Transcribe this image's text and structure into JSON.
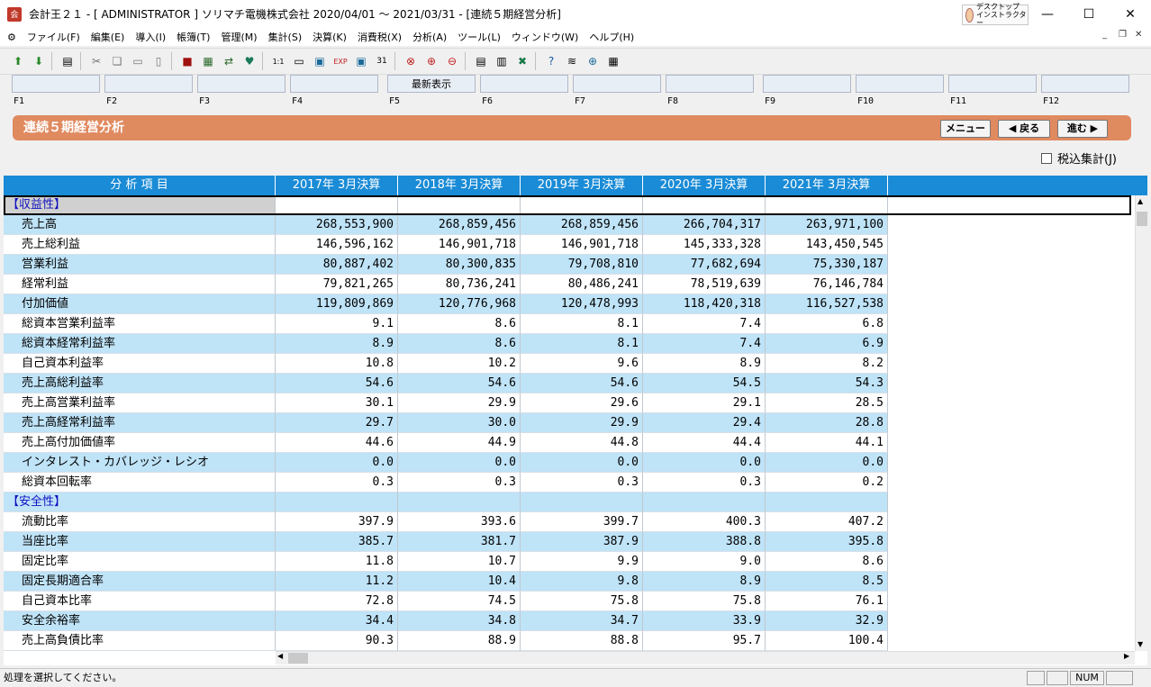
{
  "window": {
    "title": "会計王２１ - [ ADMINISTRATOR ] ソリマチ電機株式会社 2020/04/01 〜 2021/03/31 - [連続５期経営分析]",
    "app_icon": "会",
    "desktop_instructor": "デスクトップ インストラクター",
    "minimize": "—",
    "maximize": "☐",
    "close": "✕"
  },
  "menu": {
    "items": [
      "ファイル(F)",
      "編集(E)",
      "導入(I)",
      "帳簿(T)",
      "管理(M)",
      "集計(S)",
      "決算(K)",
      "消費税(X)",
      "分析(A)",
      "ツール(L)",
      "ウィンドウ(W)",
      "ヘルプ(H)"
    ]
  },
  "toolbar": {
    "icons": [
      "open-icon",
      "save-icon",
      "print-preview-icon",
      "cut-icon",
      "copy-icon",
      "paste-icon",
      "clipboard-icon",
      "book-icon",
      "journal-icon",
      "transfer-icon",
      "heart-icon",
      "easy-icon",
      "keyboard-icon",
      "voucher-icon",
      "export-icon",
      "import-icon",
      "calendar-icon",
      "delete-icon",
      "calendar-add-icon",
      "calendar-delete-icon",
      "table-icon",
      "table2-icon",
      "excel-icon",
      "help-icon",
      "layers-icon",
      "globe-icon",
      "calculator-icon"
    ]
  },
  "fkeys": {
    "buttons": [
      "",
      "",
      "",
      "",
      "最新表示",
      "",
      "",
      "",
      "",
      "",
      "",
      ""
    ],
    "labels": [
      "F1",
      "F2",
      "F3",
      "F4",
      "F5",
      "F6",
      "F7",
      "F8",
      "F9",
      "F10",
      "F11",
      "F12"
    ]
  },
  "banner": {
    "title": "連続５期経営分析",
    "menu": "メニュー",
    "back": "◀ 戻る",
    "forward": "進む ▶"
  },
  "tax_toggle": {
    "label": "税込集計(J)"
  },
  "table": {
    "headers": [
      "分 析 項 目",
      "2017年 3月決算",
      "2018年 3月決算",
      "2019年 3月決算",
      "2020年 3月決算",
      "2021年 3月決算"
    ],
    "rows": [
      {
        "label": "【収益性】",
        "section": true,
        "values": [
          "",
          "",
          "",
          "",
          ""
        ]
      },
      {
        "label": "売上高",
        "values": [
          "268,553,900",
          "268,859,456",
          "268,859,456",
          "266,704,317",
          "263,971,100"
        ]
      },
      {
        "label": "売上総利益",
        "values": [
          "146,596,162",
          "146,901,718",
          "146,901,718",
          "145,333,328",
          "143,450,545"
        ]
      },
      {
        "label": "営業利益",
        "values": [
          "80,887,402",
          "80,300,835",
          "79,708,810",
          "77,682,694",
          "75,330,187"
        ]
      },
      {
        "label": "経常利益",
        "values": [
          "79,821,265",
          "80,736,241",
          "80,486,241",
          "78,519,639",
          "76,146,784"
        ]
      },
      {
        "label": "付加価値",
        "values": [
          "119,809,869",
          "120,776,968",
          "120,478,993",
          "118,420,318",
          "116,527,538"
        ]
      },
      {
        "label": "総資本営業利益率",
        "values": [
          "9.1",
          "8.6",
          "8.1",
          "7.4",
          "6.8"
        ]
      },
      {
        "label": "総資本経常利益率",
        "values": [
          "8.9",
          "8.6",
          "8.1",
          "7.4",
          "6.9"
        ]
      },
      {
        "label": "自己資本利益率",
        "values": [
          "10.8",
          "10.2",
          "9.6",
          "8.9",
          "8.2"
        ]
      },
      {
        "label": "売上高総利益率",
        "values": [
          "54.6",
          "54.6",
          "54.6",
          "54.5",
          "54.3"
        ]
      },
      {
        "label": "売上高営業利益率",
        "values": [
          "30.1",
          "29.9",
          "29.6",
          "29.1",
          "28.5"
        ]
      },
      {
        "label": "売上高経常利益率",
        "values": [
          "29.7",
          "30.0",
          "29.9",
          "29.4",
          "28.8"
        ]
      },
      {
        "label": "売上高付加価値率",
        "values": [
          "44.6",
          "44.9",
          "44.8",
          "44.4",
          "44.1"
        ]
      },
      {
        "label": "インタレスト・カバレッジ・レシオ",
        "values": [
          "0.0",
          "0.0",
          "0.0",
          "0.0",
          "0.0"
        ]
      },
      {
        "label": "総資本回転率",
        "values": [
          "0.3",
          "0.3",
          "0.3",
          "0.3",
          "0.2"
        ]
      },
      {
        "label": "【安全性】",
        "section": true,
        "values": [
          "",
          "",
          "",
          "",
          ""
        ]
      },
      {
        "label": "流動比率",
        "values": [
          "397.9",
          "393.6",
          "399.7",
          "400.3",
          "407.2"
        ]
      },
      {
        "label": "当座比率",
        "values": [
          "385.7",
          "381.7",
          "387.9",
          "388.8",
          "395.8"
        ]
      },
      {
        "label": "固定比率",
        "values": [
          "11.8",
          "10.7",
          "9.9",
          "9.0",
          "8.6"
        ]
      },
      {
        "label": "固定長期適合率",
        "values": [
          "11.2",
          "10.4",
          "9.8",
          "8.9",
          "8.5"
        ]
      },
      {
        "label": "自己資本比率",
        "values": [
          "72.8",
          "74.5",
          "75.8",
          "75.8",
          "76.1"
        ]
      },
      {
        "label": "安全余裕率",
        "values": [
          "34.4",
          "34.8",
          "34.7",
          "33.9",
          "32.9"
        ]
      },
      {
        "label": "売上高負債比率",
        "values": [
          "90.3",
          "88.9",
          "88.8",
          "95.7",
          "100.4"
        ]
      }
    ]
  },
  "status": {
    "message": "処理を選択してください。",
    "num": "NUM"
  },
  "colors": {
    "header_bg": "#1a8bd6",
    "row_alt": "#bfe3f7",
    "banner": "#e08a60",
    "section_text": "#1010c0"
  }
}
